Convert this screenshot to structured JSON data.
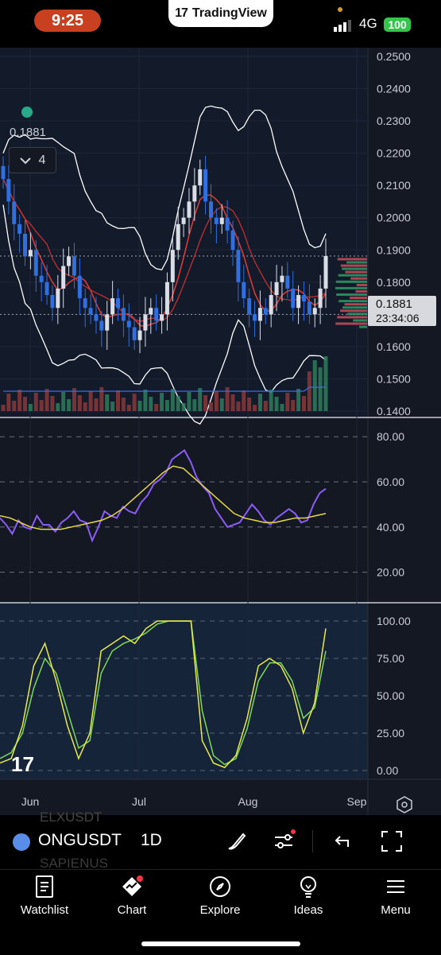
{
  "status_bar": {
    "time": "9:25",
    "app_pill": "TradingView",
    "network": "4G",
    "battery": "100"
  },
  "legend": {
    "price": "0.1881",
    "collapse_count": "4"
  },
  "price_tag": {
    "price": "0.1881",
    "countdown": "23:34:06"
  },
  "main_axis": {
    "labels": [
      "0.2500",
      "0.2400",
      "0.2300",
      "0.2200",
      "0.2100",
      "0.2000",
      "0.1900",
      "0.1800",
      "0.1700",
      "0.1600",
      "0.1500",
      "0.1400"
    ]
  },
  "rsi_axis": {
    "labels": [
      "80.00",
      "60.00",
      "40.00",
      "20.00"
    ]
  },
  "stoch_axis": {
    "labels": [
      "100.00",
      "75.00",
      "50.00",
      "25.00",
      "0.00"
    ]
  },
  "time_axis": {
    "labels": [
      "Jun",
      "Jul",
      "Aug",
      "Sep"
    ]
  },
  "toolbar": {
    "symbol": "ONGUSDT",
    "interval": "1D",
    "ghost_above": "ELXUSDT",
    "ghost_below": "SAPIENUS"
  },
  "nav": {
    "items": [
      {
        "label": "Watchlist",
        "icon": "watchlist-icon"
      },
      {
        "label": "Chart",
        "icon": "chart-icon"
      },
      {
        "label": "Explore",
        "icon": "compass-icon"
      },
      {
        "label": "Ideas",
        "icon": "lightbulb-icon"
      },
      {
        "label": "Menu",
        "icon": "menu-icon"
      }
    ]
  },
  "chart_data": {
    "type": "candlestick",
    "symbol": "ONGUSDT",
    "interval": "1D",
    "last_price": 0.1881,
    "price_range": [
      0.14,
      0.25
    ],
    "x_ticks": [
      "Jun",
      "Jul",
      "Aug",
      "Sep"
    ],
    "close_series": [
      0.212,
      0.205,
      0.198,
      0.195,
      0.188,
      0.19,
      0.182,
      0.18,
      0.176,
      0.172,
      0.178,
      0.185,
      0.188,
      0.182,
      0.175,
      0.172,
      0.17,
      0.168,
      0.165,
      0.17,
      0.175,
      0.172,
      0.168,
      0.166,
      0.162,
      0.165,
      0.17,
      0.172,
      0.168,
      0.17,
      0.18,
      0.19,
      0.198,
      0.2,
      0.205,
      0.21,
      0.215,
      0.205,
      0.2,
      0.198,
      0.2,
      0.196,
      0.19,
      0.18,
      0.175,
      0.17,
      0.168,
      0.172,
      0.17,
      0.176,
      0.18,
      0.182,
      0.178,
      0.172,
      0.176,
      0.174,
      0.17,
      0.172,
      0.178,
      0.1881
    ],
    "indicators": {
      "rsi": {
        "range": [
          10,
          85
        ],
        "levels": [
          80,
          60,
          40,
          20
        ],
        "values": [
          44,
          41,
          37,
          43,
          40,
          39,
          45,
          41,
          41,
          38,
          42,
          44,
          47,
          43,
          42,
          34,
          40,
          47,
          45,
          44,
          49,
          47,
          46,
          51,
          54,
          59,
          61,
          64,
          70,
          72,
          74,
          69,
          62,
          58,
          55,
          48,
          44,
          40,
          41,
          42,
          46,
          50,
          47,
          43,
          41,
          44,
          46,
          48,
          46,
          42,
          43,
          50,
          55,
          57
        ],
        "ma": [
          45,
          44,
          42,
          40,
          39,
          39,
          39,
          40,
          41,
          42,
          43,
          45,
          48,
          52,
          56,
          60,
          64,
          67,
          66,
          62,
          58,
          54,
          50,
          46,
          44,
          43,
          42,
          42,
          43,
          44,
          44,
          45,
          46
        ]
      },
      "stochastic": {
        "range": [
          0,
          100
        ],
        "levels": [
          100,
          75,
          50,
          25,
          0
        ],
        "k": [
          5,
          8,
          30,
          70,
          85,
          60,
          30,
          8,
          25,
          80,
          85,
          90,
          85,
          95,
          100,
          100,
          100,
          100,
          20,
          5,
          2,
          10,
          35,
          70,
          75,
          70,
          55,
          25,
          45,
          95
        ],
        "d": [
          8,
          12,
          25,
          55,
          75,
          65,
          40,
          15,
          20,
          65,
          80,
          85,
          88,
          92,
          98,
          100,
          100,
          100,
          40,
          10,
          4,
          8,
          28,
          60,
          72,
          72,
          60,
          35,
          42,
          80
        ]
      }
    }
  }
}
